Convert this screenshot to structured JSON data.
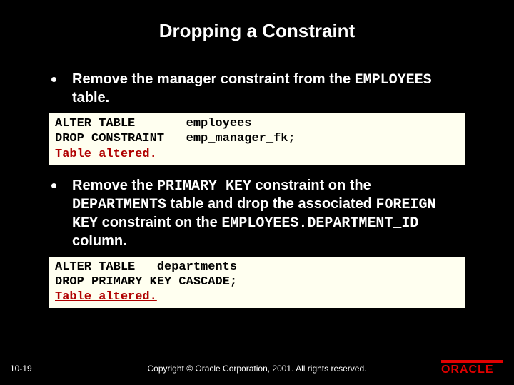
{
  "title": "Dropping a Constraint",
  "bullets": [
    {
      "text_pre": "Remove the manager constraint from the ",
      "mono1": "EMPLOYEES",
      "text_post": " table."
    },
    {
      "t1": "Remove the ",
      "m1": "PRIMARY KEY",
      "t2": " constraint on the ",
      "m2": "DEPARTMENTS",
      "t3": " table and drop the associated ",
      "m3": "FOREIGN KEY",
      "t4": " constraint on the ",
      "m4": "EMPLOYEES.DEPARTMENT_ID",
      "t5": " column."
    }
  ],
  "code_blocks": [
    {
      "line1": "ALTER TABLE       employees",
      "line2": "DROP CONSTRAINT   emp_manager_fk;",
      "result": "Table altered."
    },
    {
      "line1": "ALTER TABLE   departments",
      "line2": "DROP PRIMARY KEY CASCADE;",
      "result": "Table altered."
    }
  ],
  "footer": {
    "page": "10-19",
    "copyright": "Copyright © Oracle Corporation, 2001. All rights reserved.",
    "logo_text": "ORACLE"
  }
}
